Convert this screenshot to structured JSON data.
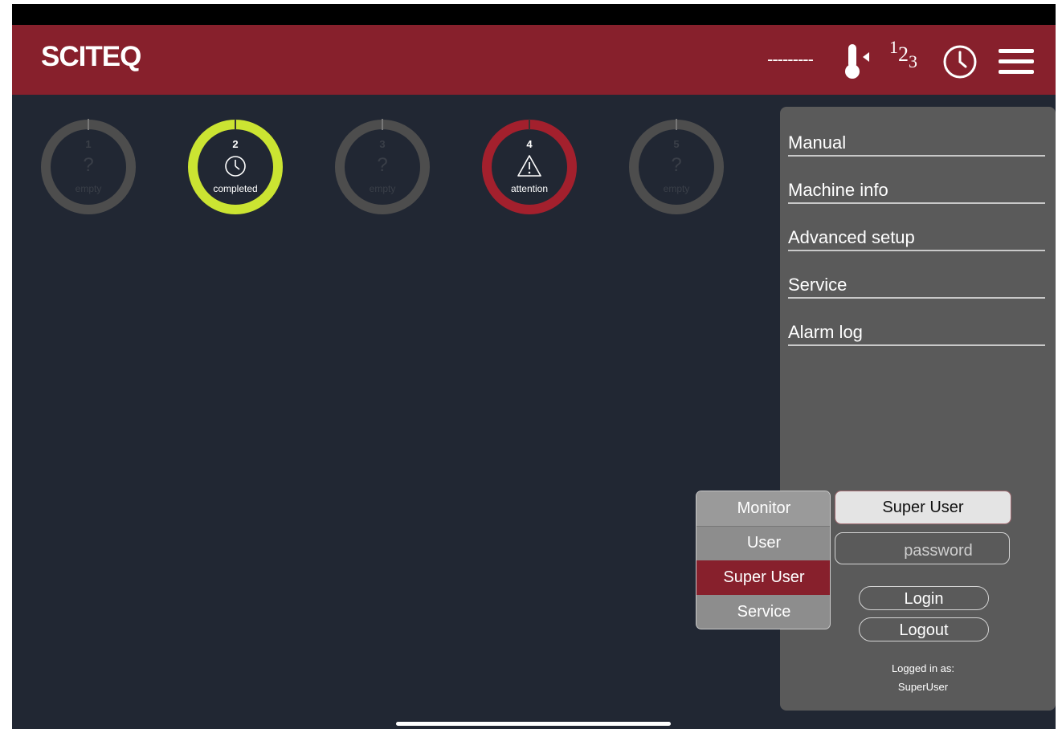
{
  "header": {
    "logo": "SCITEQ",
    "temperature": "---------",
    "number_format": {
      "a": "1",
      "b": "2",
      "c": "3"
    },
    "colors": {
      "bar": "#87202c"
    }
  },
  "positions": [
    {
      "number": "1",
      "symbol": "?",
      "status": "empty",
      "state": "empty",
      "ring_color": "#4d4d4d"
    },
    {
      "number": "2",
      "symbol": "clock-icon",
      "status": "completed",
      "state": "completed",
      "ring_color": "#cbe432"
    },
    {
      "number": "3",
      "symbol": "?",
      "status": "empty",
      "state": "empty",
      "ring_color": "#4d4d4d"
    },
    {
      "number": "4",
      "symbol": "warning-icon",
      "status": "attention",
      "state": "attention",
      "ring_color": "#a3202d"
    },
    {
      "number": "5",
      "symbol": "?",
      "status": "empty",
      "state": "empty",
      "ring_color": "#4d4d4d"
    }
  ],
  "side_menu": {
    "items": [
      {
        "label": "Manual"
      },
      {
        "label": "Machine info"
      },
      {
        "label": "Advanced setup"
      },
      {
        "label": "Service"
      },
      {
        "label": "Alarm log"
      }
    ]
  },
  "login": {
    "selected_role": "Super User",
    "password_placeholder": "password",
    "login_label": "Login",
    "logout_label": "Logout",
    "logged_in_as_label": "Logged in as:",
    "logged_in_user": "SuperUser"
  },
  "role_dropdown": {
    "options": [
      {
        "label": "Monitor"
      },
      {
        "label": "User"
      },
      {
        "label": "Super User"
      },
      {
        "label": "Service"
      }
    ],
    "selected_index": 2
  }
}
